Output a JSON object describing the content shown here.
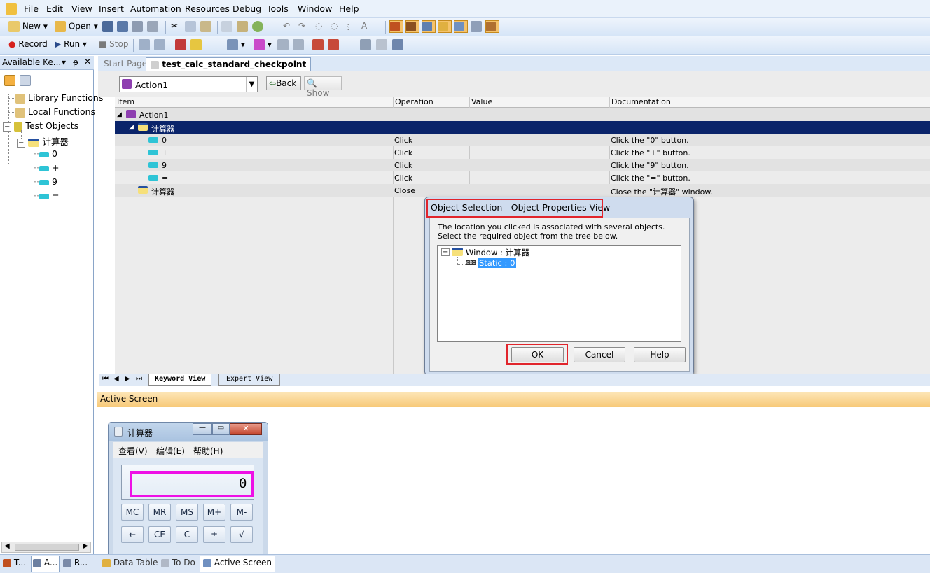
{
  "menu": [
    "File",
    "Edit",
    "View",
    "Insert",
    "Automation",
    "Resources",
    "Debug",
    "Tools",
    "Window",
    "Help"
  ],
  "toolbar1": {
    "new": "New",
    "open": "Open"
  },
  "toolbar2": {
    "record": "Record",
    "run": "Run",
    "stop": "Stop"
  },
  "left_pane": {
    "title": "Available Ke...",
    "items": [
      "Library Functions",
      "Local Functions",
      "Test Objects",
      "计算器",
      "0",
      "+",
      "9",
      "="
    ]
  },
  "tabs": {
    "start_page": "Start Page",
    "active": "test_calc_standard_checkpoint"
  },
  "action_bar": {
    "action": "Action1",
    "back": "Back",
    "show": "Show"
  },
  "grid": {
    "headers": [
      "Item",
      "Operation",
      "Value",
      "Documentation"
    ],
    "rows": [
      {
        "item": "Action1",
        "op": "",
        "value": "",
        "doc": ""
      },
      {
        "item": "计算器",
        "op": "",
        "value": "",
        "doc": ""
      },
      {
        "item": "0",
        "op": "Click",
        "value": "",
        "doc": "Click the \"0\" button."
      },
      {
        "item": "+",
        "op": "Click",
        "value": "",
        "doc": "Click the \"+\" button."
      },
      {
        "item": "9",
        "op": "Click",
        "value": "",
        "doc": "Click the \"9\" button."
      },
      {
        "item": "=",
        "op": "Click",
        "value": "",
        "doc": "Click the \"=\" button."
      },
      {
        "item": "计算器",
        "op": "Close",
        "value": "",
        "doc": "Close the \"计算器\" window."
      }
    ]
  },
  "view_tabs": {
    "keyword": "Keyword View",
    "expert": "Expert View"
  },
  "dialog": {
    "title": "Object Selection - Object Properties View",
    "line1": "The location you clicked is associated with several objects.",
    "line2": "Select the required object from the tree below.",
    "tree_parent": "Window : 计算器",
    "tree_child": "Static : 0",
    "ok": "OK",
    "cancel": "Cancel",
    "help": "Help"
  },
  "active_screen": {
    "title": "Active Screen",
    "calc_title": "计算器",
    "calc_menu": [
      "查看(V)",
      "编辑(E)",
      "帮助(H)"
    ],
    "display": "0",
    "row1": [
      "MC",
      "MR",
      "MS",
      "M+",
      "M-"
    ],
    "row2": [
      "←",
      "CE",
      "C",
      "±",
      "√"
    ]
  },
  "statusbar": {
    "left_tabs": [
      "T...",
      "A...",
      "R..."
    ],
    "tabs": [
      "Data Table",
      "To Do",
      "Active Screen"
    ]
  },
  "colors": {
    "selection": "#0a246a",
    "highlight_box": "#e1252c",
    "magenta_box": "#ee10e6"
  }
}
